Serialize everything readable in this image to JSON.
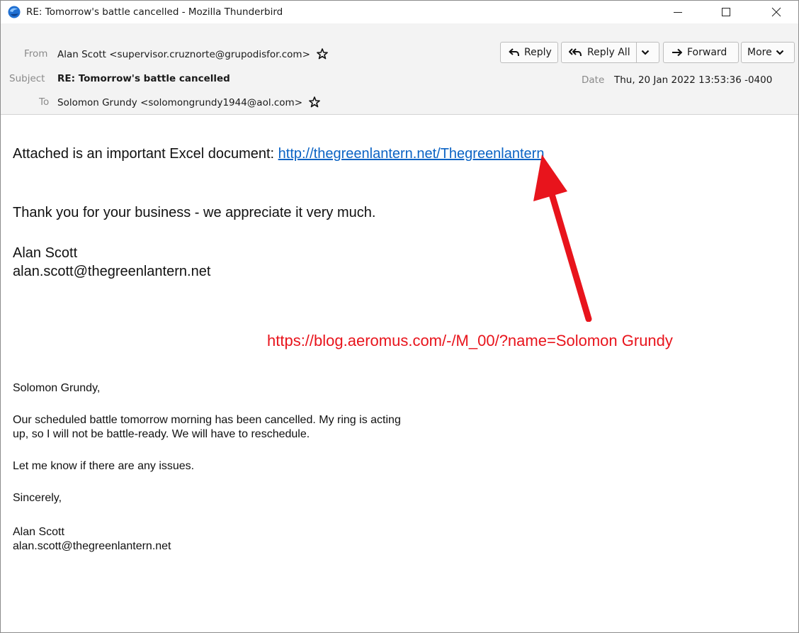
{
  "window": {
    "title": "RE: Tomorrow's battle cancelled - Mozilla Thunderbird",
    "app_icon": "thunderbird-icon",
    "controls": [
      "minimize-icon",
      "maximize-icon",
      "close-icon"
    ]
  },
  "header": {
    "from_label": "From",
    "from_value": "Alan Scott <supervisor.cruznorte@grupodisfor.com>",
    "subject_label": "Subject",
    "subject_value": "RE: Tomorrow's battle cancelled",
    "to_label": "To",
    "to_value": "Solomon Grundy <solomongrundy1944@aol.com>",
    "date_label": "Date",
    "date_value": "Thu, 20 Jan 2022 13:53:36 -0400",
    "star_icon": "star-outline-icon"
  },
  "toolbar": {
    "reply_label": "Reply",
    "reply_all_label": "Reply All",
    "forward_label": "Forward",
    "more_label": "More"
  },
  "body": {
    "attached_text": "Attached is an important Excel document: ",
    "attached_link": "http://thegreenlantern.net/Thegreenlantern",
    "thanks": "Thank you for your business - we appreciate it very much.",
    "sig1_name": "Alan Scott",
    "sig1_email": "alan.scott@thegreenlantern.net",
    "annotation": "https://blog.aeromus.com/-/M_00/?name=Solomon Grundy",
    "annotation_color": "#e8141c",
    "quoted": {
      "greeting": "Solomon Grundy,",
      "para1_line1": "Our scheduled battle tomorrow morning has been cancelled.  My ring is acting",
      "para1_line2": "up, so I will not be battle-ready.  We will have to reschedule.",
      "para2": "Let me know if there are any issues.",
      "closing": "Sincerely,",
      "name": "Alan Scott",
      "email": "alan.scott@thegreenlantern.net"
    }
  }
}
